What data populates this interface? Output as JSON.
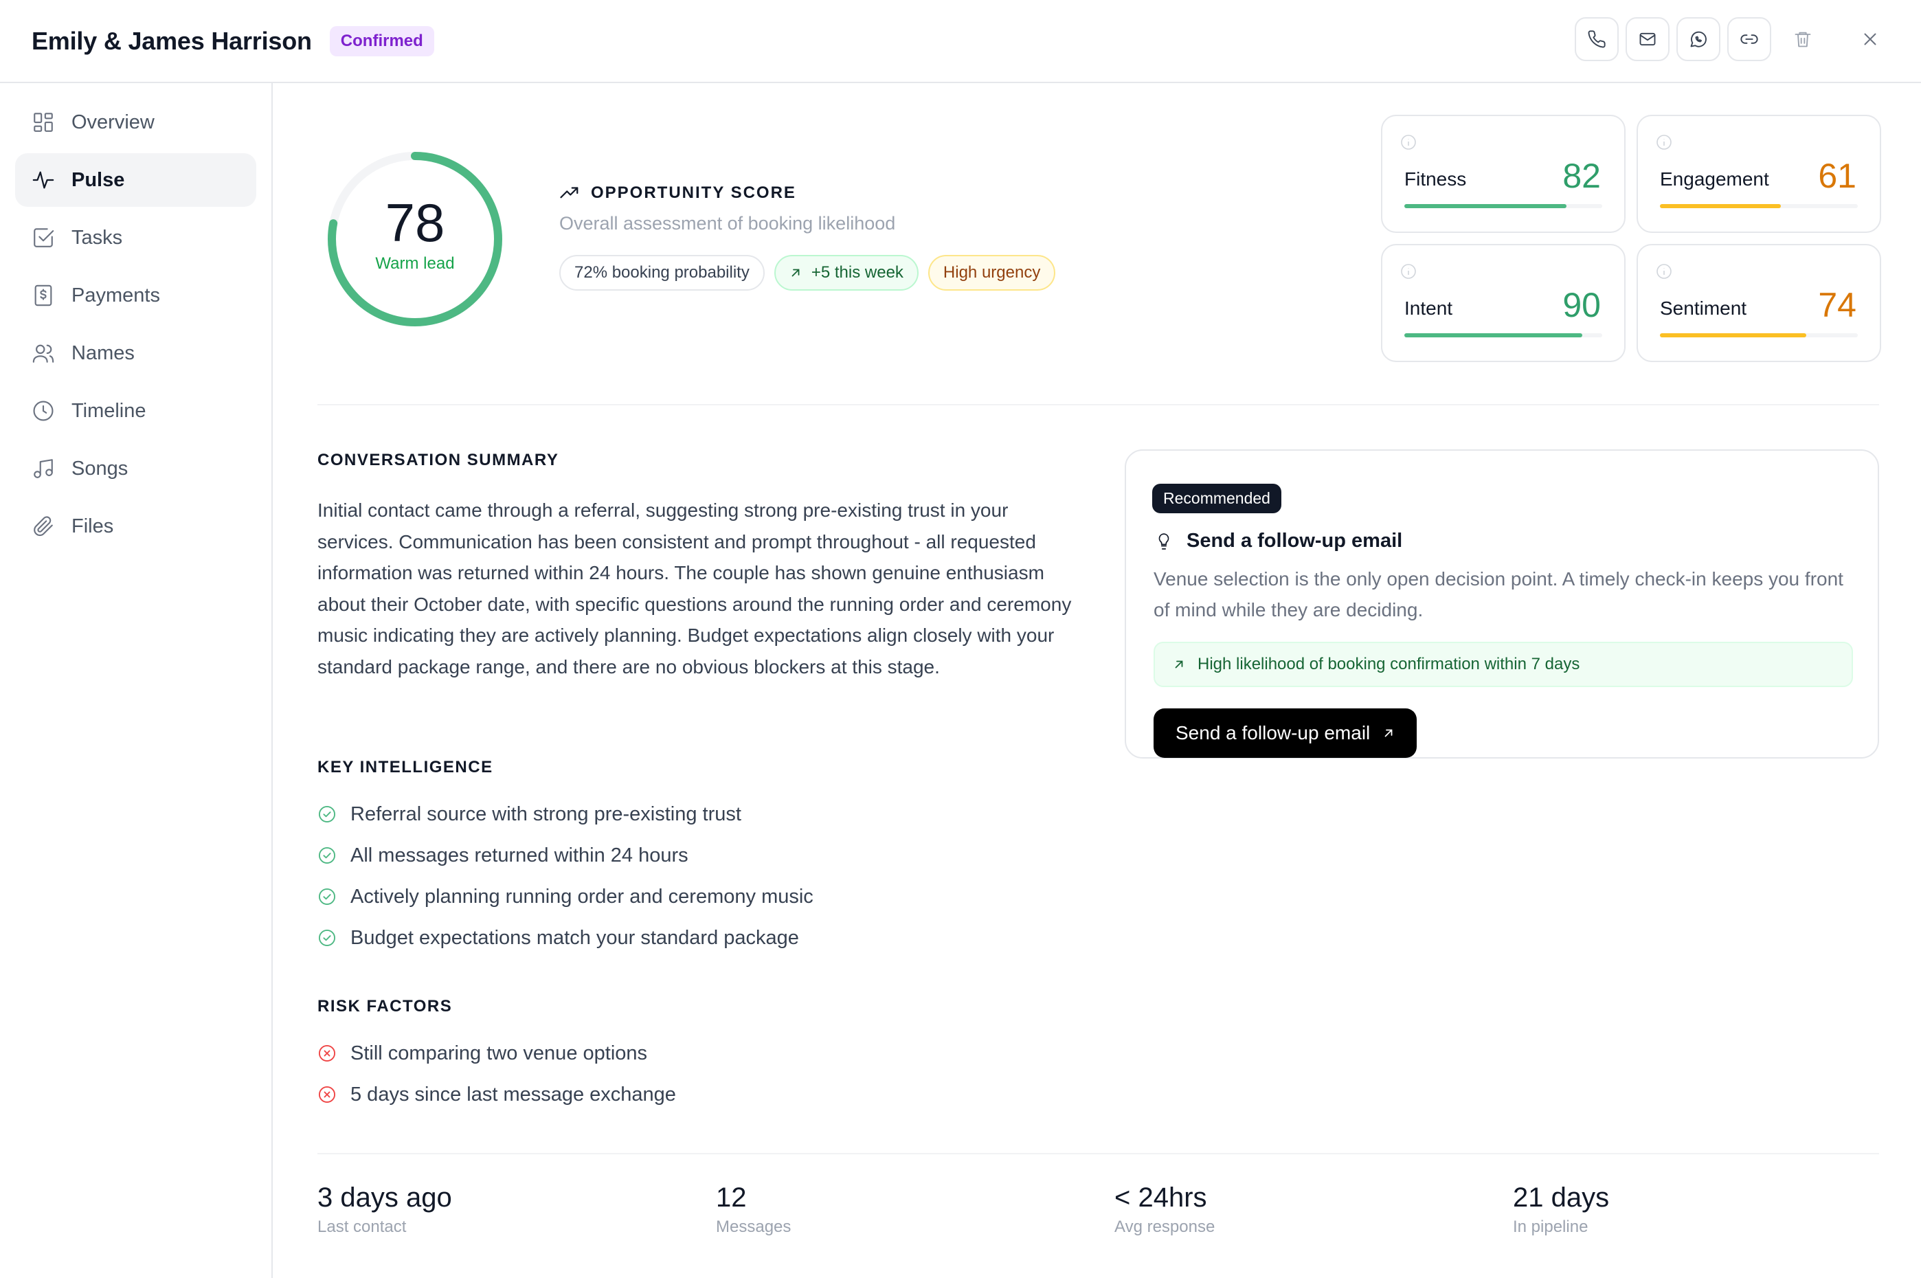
{
  "header": {
    "title": "Emily & James Harrison",
    "status": "Confirmed"
  },
  "sidebar": {
    "items": [
      {
        "label": "Overview",
        "icon": "grid-icon"
      },
      {
        "label": "Pulse",
        "icon": "activity-icon",
        "active": true
      },
      {
        "label": "Tasks",
        "icon": "checkbox-icon"
      },
      {
        "label": "Payments",
        "icon": "receipt-icon"
      },
      {
        "label": "Names",
        "icon": "users-icon"
      },
      {
        "label": "Timeline",
        "icon": "clock-icon"
      },
      {
        "label": "Songs",
        "icon": "music-icon"
      },
      {
        "label": "Files",
        "icon": "paperclip-icon"
      }
    ]
  },
  "score": {
    "value": "78",
    "fraction": 0.78,
    "label": "Warm lead",
    "color": "#4db883"
  },
  "opportunity": {
    "title": "OPPORTUNITY SCORE",
    "subtitle": "Overall assessment of booking likelihood",
    "pills": {
      "probability": "72% booking probability",
      "trend": "+5 this week",
      "urgency": "High urgency"
    }
  },
  "metrics": [
    {
      "label": "Fitness",
      "value": "82",
      "fraction": 0.82,
      "color": "#2f9e6a",
      "bar": "#4db883"
    },
    {
      "label": "Engagement",
      "value": "61",
      "fraction": 0.61,
      "color": "#d97706",
      "bar": "#fbbf24"
    },
    {
      "label": "Intent",
      "value": "90",
      "fraction": 0.9,
      "color": "#2f9e6a",
      "bar": "#4db883"
    },
    {
      "label": "Sentiment",
      "value": "74",
      "fraction": 0.74,
      "color": "#d97706",
      "bar": "#fbbf24"
    }
  ],
  "summary": {
    "label": "CONVERSATION SUMMARY",
    "text": "Initial contact came through a referral, suggesting strong pre-existing trust in your services. Communication has been consistent and prompt throughout - all requested information was returned within 24 hours. The couple has shown genuine enthusiasm about their October date, with specific questions around the running order and ceremony music indicating they are actively planning. Budget expectations align closely with your standard package range, and there are no obvious blockers at this stage."
  },
  "intelligence": {
    "label": "KEY INTELLIGENCE",
    "items": [
      "Referral source with strong pre-existing trust",
      "All messages returned within 24 hours",
      "Actively planning running order and ceremony music",
      "Budget expectations match your standard package"
    ]
  },
  "risks": {
    "label": "RISK FACTORS",
    "items": [
      "Still comparing two venue options",
      "5 days since last message exchange"
    ]
  },
  "recommendation": {
    "badge": "Recommended",
    "title": "Send a follow-up email",
    "description": "Venue selection is the only open decision point. A timely check-in keeps you front of mind while they are deciding.",
    "hint": "High likelihood of booking confirmation within 7 days",
    "cta": "Send a follow-up email"
  },
  "stats": [
    {
      "value": "3 days ago",
      "label": "Last contact"
    },
    {
      "value": "12",
      "label": "Messages"
    },
    {
      "value": "< 24hrs",
      "label": "Avg response"
    },
    {
      "value": "21 days",
      "label": "In pipeline"
    }
  ]
}
